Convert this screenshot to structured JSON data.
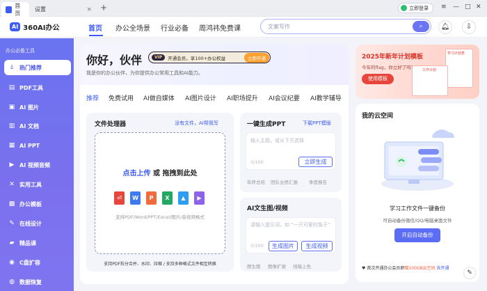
{
  "browser": {
    "tabs": [
      {
        "label": "首页"
      },
      {
        "label": "设置"
      }
    ],
    "new_tab": "+",
    "close": "×",
    "login_label": "立即登录",
    "window_controls": [
      "≡",
      "—",
      "□",
      "✕"
    ]
  },
  "header": {
    "logo_text": "360AI办公",
    "logo_badge": "AI",
    "nav": [
      "首页",
      "办公全场景",
      "行业必备",
      "周鸿祎免费课"
    ],
    "search_placeholder": "文案写作"
  },
  "sidebar": {
    "title": "办公必备工具",
    "items": [
      {
        "label": "热门推荐",
        "icon": "fire-icon"
      },
      {
        "label": "PDF工具",
        "icon": "pdf-icon"
      },
      {
        "label": "AI 图片",
        "icon": "image-icon"
      },
      {
        "label": "AI 文档",
        "icon": "doc-icon"
      },
      {
        "label": "AI PPT",
        "icon": "ppt-icon"
      },
      {
        "label": "AI 视频音频",
        "icon": "video-icon"
      },
      {
        "label": "实用工具",
        "icon": "tools-icon"
      },
      {
        "label": "办公模板",
        "icon": "template-icon"
      },
      {
        "label": "在线设计",
        "icon": "design-icon"
      },
      {
        "label": "精品课",
        "icon": "course-icon"
      },
      {
        "label": "C盘扩容",
        "icon": "disk-icon"
      },
      {
        "label": "数据恢复",
        "icon": "recover-icon"
      }
    ]
  },
  "hero": {
    "title": "你好，伙伴",
    "vip_badge": "VIP",
    "vip_text": "开通会员，享100+办公权益",
    "vip_button": "立即开通",
    "subtitle": "我是你的办公伙伴，为你提供办公常用工具和AI能力。"
  },
  "content_tabs": [
    "推荐",
    "免费试用",
    "AI做自媒体",
    "AI图片设计",
    "AI职场提升",
    "AI会议纪要",
    "AI教学辅导"
  ],
  "file_processor": {
    "title": "文件处理器",
    "link": "没有文件，AI帮我写",
    "upload_text": "点击上传",
    "or_text": "或",
    "drag_text": "拖拽到此处",
    "file_types": [
      "pdf",
      "word",
      "ppt",
      "excel",
      "image",
      "video"
    ],
    "support_text": "支持PDF/Word/PPT/Excel/图片/音视频格式",
    "footer": "支持PDF拆分合并、水印、压缩 / 支持多种格式文件相互转换"
  },
  "ppt_card": {
    "title": "一键生成PPT",
    "link": "下载PPT模版",
    "placeholder": "输入主题，或从下方选择",
    "counter": "0/100",
    "button": "立即生成",
    "tags": [
      "年终总结",
      "团队业绩汇报",
      "季度报告"
    ]
  },
  "image_card": {
    "title": "AI文生图/视频",
    "placeholder": "请输入提示词，如 “一只可爱的兔子”",
    "counter": "0/100",
    "button_image": "生成图片",
    "button_video": "生成视频",
    "tags": [
      "图生图",
      "图像扩展",
      "线稿上色"
    ]
  },
  "banner": {
    "title": "2025年新年计划模板",
    "subtitle": "今年的flag，你立好了吗？",
    "button": "使用模板",
    "doc_label": "学习计划表",
    "doc_label2": "工作计划"
  },
  "cloud": {
    "title": "我的云空间",
    "heading": "学习工作文件一键备份",
    "desc": "可自动备份微信/QQ/电脑桌面文件",
    "button": "开启自动备份",
    "footer_prefix": "首次开通办公会员即",
    "footer_highlight": "赠100GB云空间",
    "footer_link": "去开通"
  },
  "colors": {
    "accent": "#3d5bf5",
    "sidebar": "#6a73f0",
    "highlight": "#ff5a3c"
  }
}
